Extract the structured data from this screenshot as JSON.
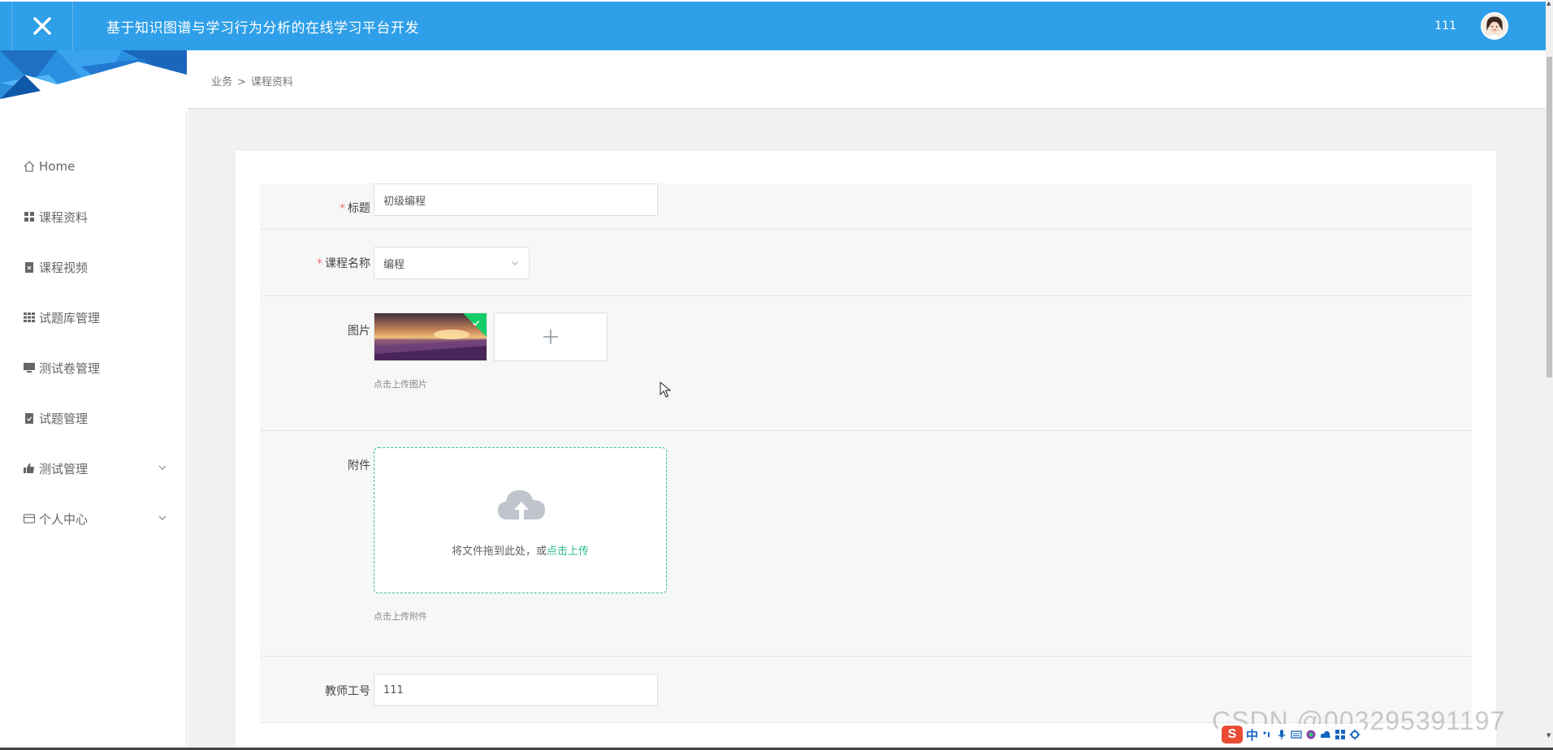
{
  "header": {
    "title": "基于知识图谱与学习行为分析的在线学习平台开发",
    "username": "111"
  },
  "sidebar": {
    "items": [
      {
        "label": "Home",
        "icon": "home-icon"
      },
      {
        "label": "课程资料",
        "icon": "grid-icon"
      },
      {
        "label": "课程视频",
        "icon": "clipboard-x-icon"
      },
      {
        "label": "试题库管理",
        "icon": "grid-nine-icon"
      },
      {
        "label": "测试卷管理",
        "icon": "monitor-icon"
      },
      {
        "label": "试题管理",
        "icon": "clipboard-check-icon"
      },
      {
        "label": "测试管理",
        "icon": "thumb-icon",
        "expandable": true
      },
      {
        "label": "个人中心",
        "icon": "wallet-icon",
        "expandable": true
      }
    ]
  },
  "breadcrumb": {
    "root": "业务",
    "separator": ">",
    "current": "课程资料"
  },
  "form": {
    "title": {
      "label": "标题",
      "required": true,
      "value": "初级编程"
    },
    "course_name": {
      "label": "课程名称",
      "required": true,
      "value": "编程"
    },
    "image": {
      "label": "图片",
      "hint": "点击上传图片"
    },
    "attachment": {
      "label": "附件",
      "drop_text": "将文件拖到此处，或",
      "drop_link": "点击上传",
      "hint": "点击上传附件"
    },
    "teacher_id": {
      "label": "教师工号",
      "value": "111"
    }
  },
  "overlay": {
    "watermark": "CSDN @003295391197",
    "ime_label": "中"
  },
  "colors": {
    "header_bg": "#2e9fe8",
    "required": "#f56c6c",
    "accent_green": "#2fbc8a",
    "upload_success": "#13ce66"
  }
}
